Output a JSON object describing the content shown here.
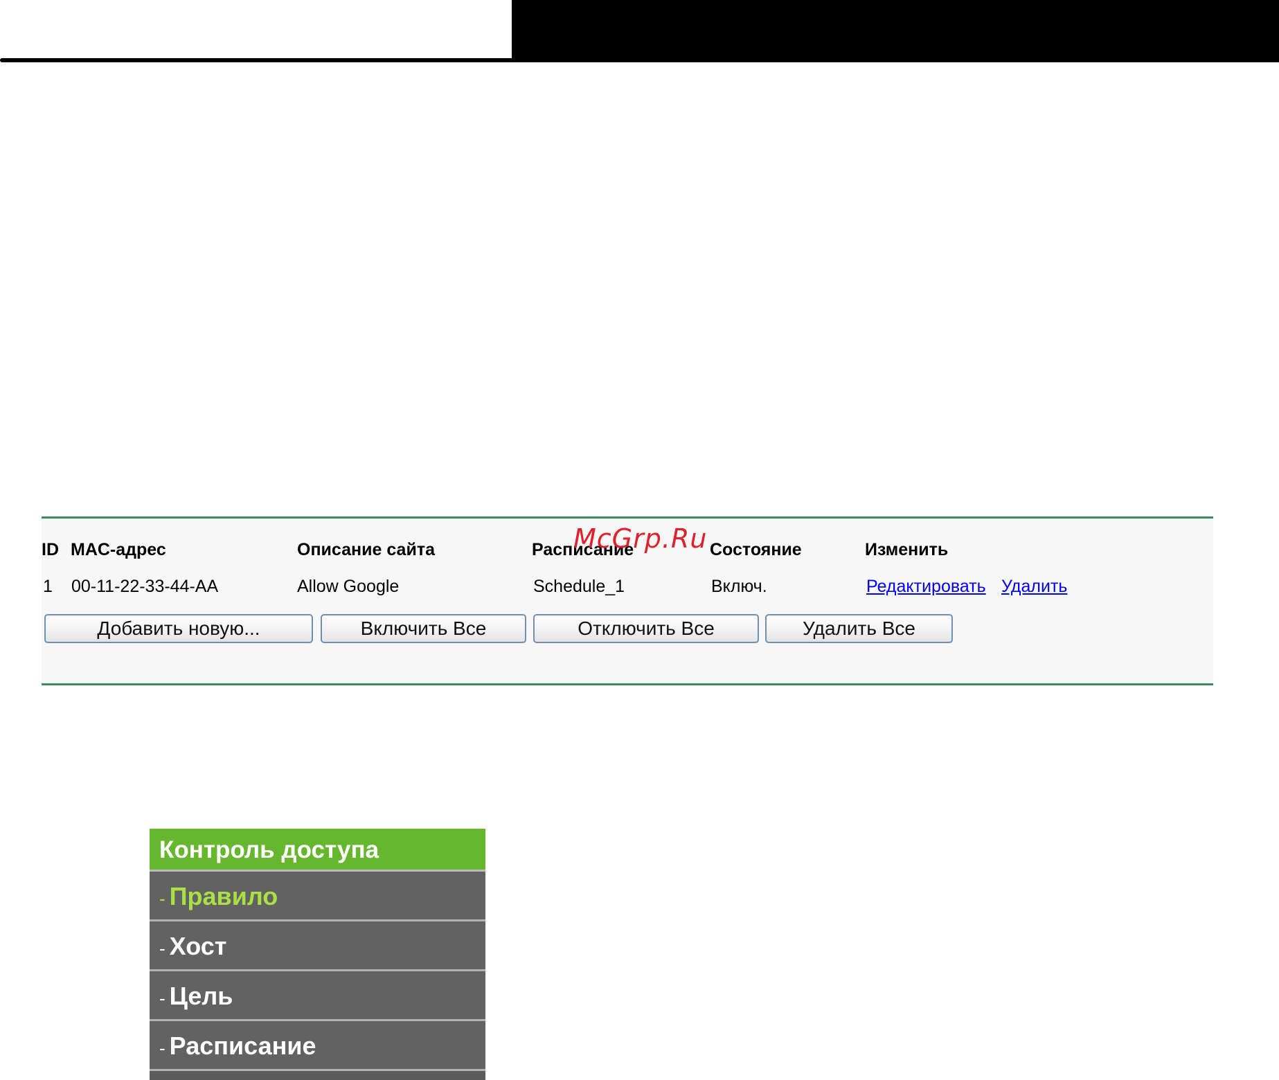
{
  "watermark": "McGrp.Ru",
  "rules_table": {
    "headers": {
      "id": "ID",
      "mac": "MAC-адрес",
      "site": "Описание сайта",
      "schedule": "Расписание",
      "status": "Состояние",
      "modify": "Изменить"
    },
    "rows": [
      {
        "id": "1",
        "mac": "00-11-22-33-44-AA",
        "site": "Allow Google",
        "schedule": "Schedule_1",
        "status": "Включ.",
        "edit": "Редактировать",
        "delete": "Удалить"
      }
    ],
    "buttons": {
      "add_new": "Добавить новую...",
      "enable_all": "Включить Все",
      "disable_all": "Отключить Все",
      "delete_all": "Удалить Все"
    }
  },
  "side_menu": {
    "header": "Контроль доступа",
    "items": [
      {
        "dash": "-",
        "label": "Правило",
        "active": true
      },
      {
        "dash": "-",
        "label": "Хост",
        "active": false
      },
      {
        "dash": "-",
        "label": "Цель",
        "active": false
      },
      {
        "dash": "-",
        "label": "Расписание",
        "active": false
      }
    ],
    "colors": {
      "header_bg": "#66b72e",
      "item_bg": "#626262",
      "active_text": "#a9e046"
    }
  },
  "colors": {
    "panel_border": "#3c8a5a",
    "link": "#0000ee"
  }
}
